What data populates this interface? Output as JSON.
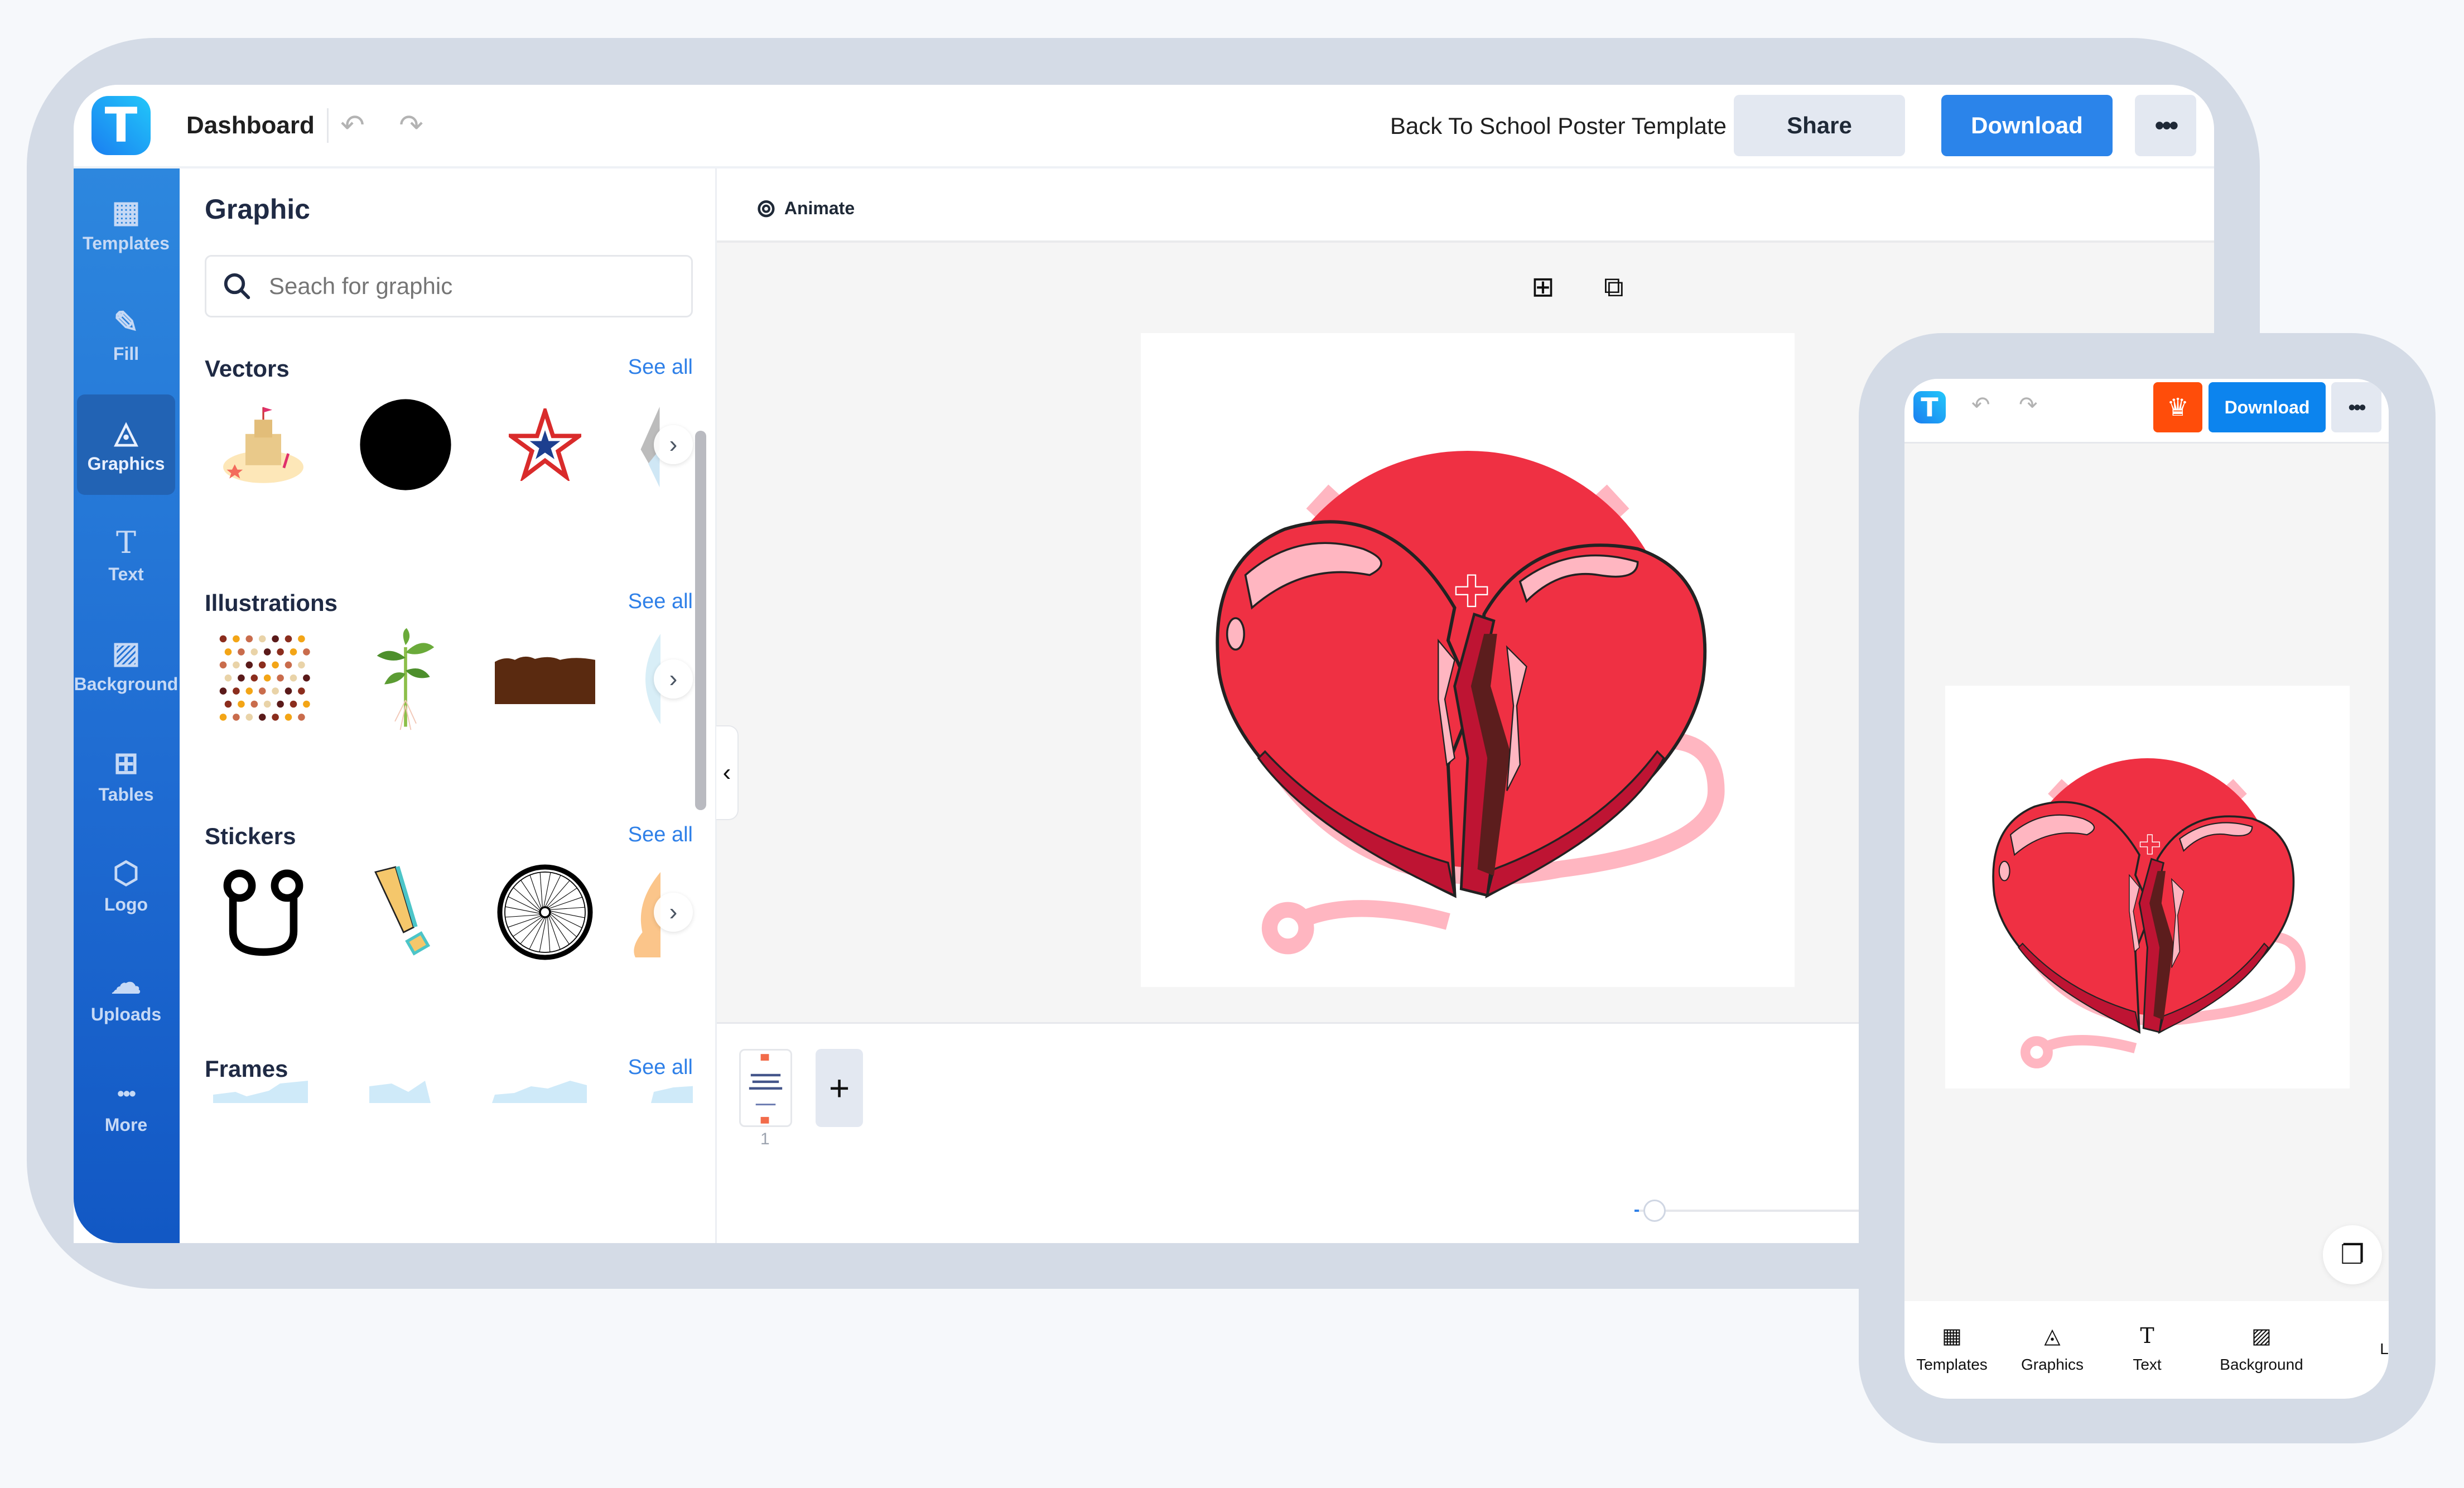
{
  "header": {
    "logo_letter": "T",
    "dashboard_label": "Dashboard",
    "undo_icon": "↶",
    "redo_icon": "↷",
    "document_title": "Back To School Poster Template",
    "share_label": "Share",
    "download_label": "Download",
    "more_label": "•••"
  },
  "sidebar": {
    "items": [
      {
        "label": "Templates",
        "icon": "templates-icon",
        "glyph": "▦"
      },
      {
        "label": "Fill",
        "icon": "pencil-icon",
        "glyph": "✎"
      },
      {
        "label": "Graphics",
        "icon": "shapes-icon",
        "glyph": "◬",
        "active": true
      },
      {
        "label": "Text",
        "icon": "text-icon",
        "glyph": "T"
      },
      {
        "label": "Background",
        "icon": "background-icon",
        "glyph": "▨"
      },
      {
        "label": "Tables",
        "icon": "table-icon",
        "glyph": "⊞"
      },
      {
        "label": "Logo",
        "icon": "logo-icon",
        "glyph": "⬡"
      },
      {
        "label": "Uploads",
        "icon": "cloud-upload-icon",
        "glyph": "☁"
      },
      {
        "label": "More",
        "icon": "more-icon",
        "glyph": "•••"
      }
    ]
  },
  "panel": {
    "title": "Graphic",
    "search_placeholder": "Seach for graphic",
    "search_icon": "⚲",
    "sections": [
      {
        "title": "Vectors",
        "see_all": "See all",
        "items": [
          "sandcastle",
          "black-circle",
          "patriotic-star",
          "partial-item"
        ]
      },
      {
        "title": "Illustrations",
        "see_all": "See all",
        "items": [
          "autumn-leaves-pattern",
          "seedling",
          "soil-block",
          "partial-item"
        ]
      },
      {
        "title": "Stickers",
        "see_all": "See all",
        "items": [
          "stethoscope",
          "exclamation-mark",
          "bicycle-wheel",
          "partial-item"
        ]
      },
      {
        "title": "Frames",
        "see_all": "See all",
        "items": [
          "frame-1",
          "frame-2",
          "frame-3",
          "frame-4"
        ]
      }
    ],
    "next_glyph": "›",
    "collapse_glyph": "‹"
  },
  "workspace": {
    "animate_label": "Animate",
    "animate_icon": "⊚",
    "add_page_icon": "⊞",
    "duplicate_icon": "⧉",
    "expand_glyph": "⌄",
    "page_number": "1",
    "add_page_label": "+",
    "canvas_graphic": "broken-heart-stethoscope"
  },
  "phone": {
    "logo_letter": "T",
    "undo_icon": "↶",
    "redo_icon": "↷",
    "crown_icon": "♛",
    "download_label": "Download",
    "more_label": "•••",
    "pages_icon": "❐",
    "nav": [
      {
        "label": "Templates",
        "glyph": "▦"
      },
      {
        "label": "Graphics",
        "glyph": "◬"
      },
      {
        "label": "Text",
        "glyph": "T"
      },
      {
        "label": "Background",
        "glyph": "▨"
      },
      {
        "label": "L",
        "glyph": ""
      }
    ]
  },
  "colors": {
    "accent": "#2b84ea",
    "sidebar_top": "#2d87de",
    "sidebar_bottom": "#1258c4",
    "premium": "#ff4d0a",
    "frame": "#d4dbe6",
    "heart": "#ef3043",
    "heart_dark": "#be1433",
    "heart_highlight": "#ffb6c1"
  }
}
